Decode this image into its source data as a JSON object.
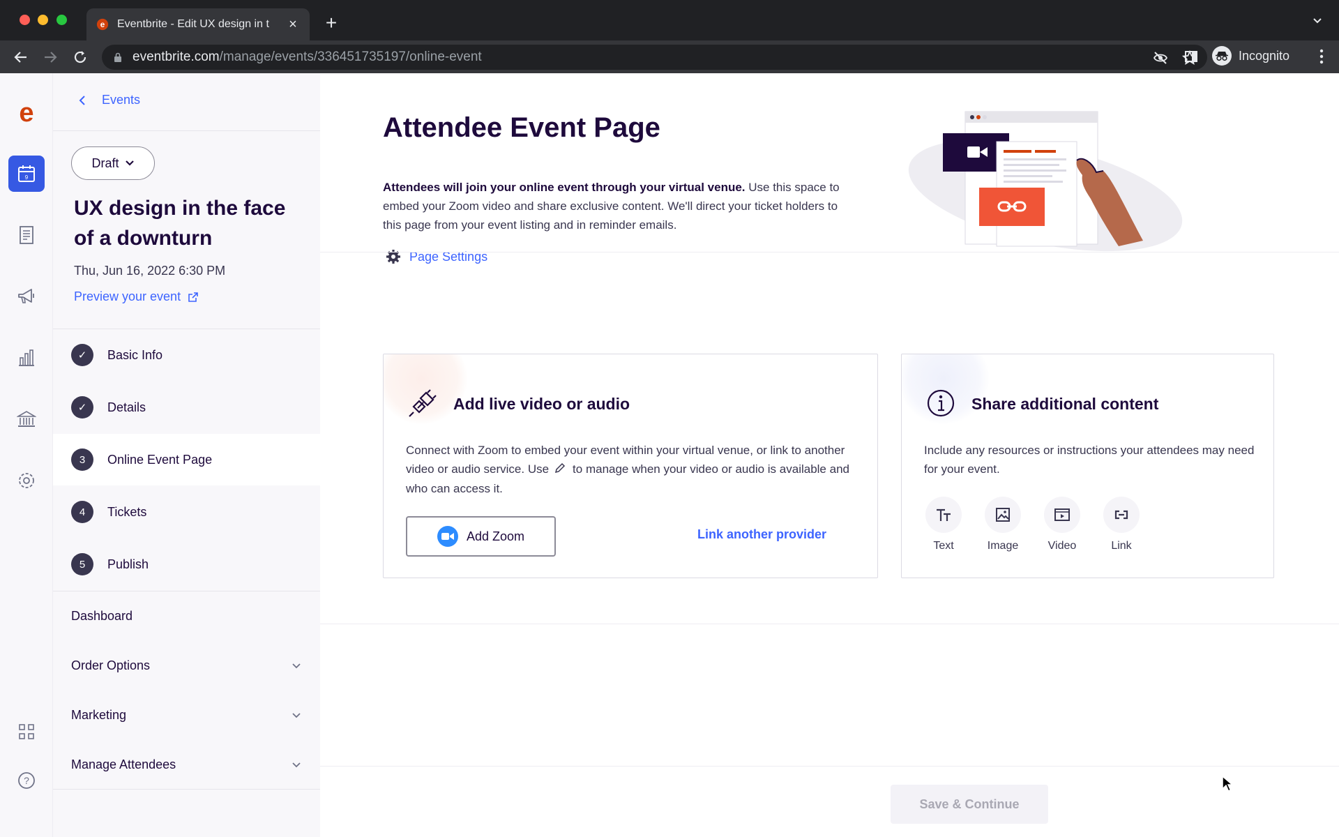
{
  "browser": {
    "tab_title": "Eventbrite - Edit UX design in t",
    "url_host": "eventbrite.com",
    "url_path": "/manage/events/336451735197/online-event",
    "profile_label": "Incognito"
  },
  "rail": {
    "items": [
      "eventbrite-logo",
      "calendar-icon",
      "orders-icon",
      "megaphone-icon",
      "bar-chart-icon",
      "bank-icon",
      "gear-icon",
      "apps-grid-icon",
      "help-icon"
    ],
    "active": "calendar-icon",
    "accent_color": "#3659e3"
  },
  "sidebar": {
    "back_label": "Events",
    "status_label": "Draft",
    "event_title": "UX design in the face of a downturn",
    "event_date": "Thu, Jun 16, 2022 6:30 PM",
    "preview_label": "Preview your event",
    "steps": [
      {
        "marker": "✓",
        "label": "Basic Info",
        "state": "complete"
      },
      {
        "marker": "✓",
        "label": "Details",
        "state": "complete"
      },
      {
        "marker": "3",
        "label": "Online Event Page",
        "state": "active"
      },
      {
        "marker": "4",
        "label": "Tickets",
        "state": "pending"
      },
      {
        "marker": "5",
        "label": "Publish",
        "state": "pending"
      }
    ],
    "sections": [
      {
        "label": "Dashboard",
        "expandable": false
      },
      {
        "label": "Order Options",
        "expandable": true
      },
      {
        "label": "Marketing",
        "expandable": true
      },
      {
        "label": "Manage Attendees",
        "expandable": true
      }
    ]
  },
  "main": {
    "title": "Attendee Event Page",
    "intro_bold": "Attendees will join your online event through your virtual venue.",
    "intro_rest": " Use this space to embed your Zoom video and share exclusive content. We'll direct your ticket holders to this page from your event listing and in reminder emails.",
    "page_settings_label": "Page Settings",
    "video_card": {
      "title": "Add live video or audio",
      "desc_part1": "Connect with Zoom to embed your event within your virtual venue, or link to another video or audio service. Use",
      "desc_part2": "to manage when your video or audio is available and who can access it.",
      "zoom_button_label": "Add Zoom",
      "link_provider_label": "Link another provider"
    },
    "share_card": {
      "title": "Share additional content",
      "desc": "Include any resources or instructions your attendees may need for your event.",
      "options": [
        {
          "label": "Text",
          "icon": "text-icon"
        },
        {
          "label": "Image",
          "icon": "image-icon"
        },
        {
          "label": "Video",
          "icon": "video-icon"
        },
        {
          "label": "Link",
          "icon": "link-icon"
        }
      ]
    },
    "save_button_label": "Save & Continue"
  },
  "colors": {
    "brand": "#d1410c",
    "link": "#3d64ff",
    "text_dark": "#1e0a3c",
    "zoom_blue": "#2d8cff"
  }
}
